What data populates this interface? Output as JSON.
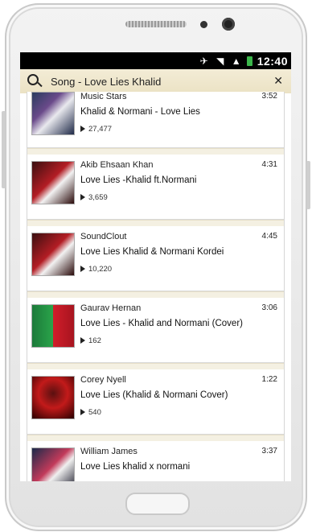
{
  "status": {
    "time": "12:40"
  },
  "search": {
    "query": "Song - Love Lies Khalid"
  },
  "results": [
    {
      "channel": "Music Stars",
      "title": "Khalid & Normani - Love Lies",
      "plays": "27,477",
      "duration": "3:52"
    },
    {
      "channel": "Akib Ehsaan Khan",
      "title": "Love Lies -Khalid ft.Normani",
      "plays": "3,659",
      "duration": "4:31"
    },
    {
      "channel": "SoundClout",
      "title": "Love Lies Khalid & Normani Kordei",
      "plays": "10,220",
      "duration": "4:45"
    },
    {
      "channel": "Gaurav Hernan",
      "title": "Love Lies - Khalid and Normani (Cover)",
      "plays": "162",
      "duration": "3:06"
    },
    {
      "channel": "Corey Nyell",
      "title": "Love Lies (Khalid & Normani Cover)",
      "plays": "540",
      "duration": "1:22"
    },
    {
      "channel": "William James",
      "title": "Love Lies khalid x normani",
      "plays": "",
      "duration": "3:37"
    }
  ]
}
